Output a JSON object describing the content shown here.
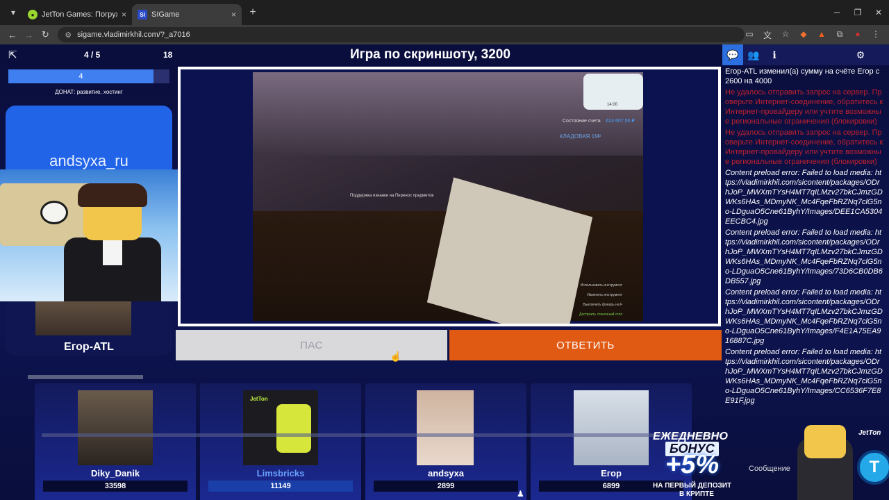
{
  "browser": {
    "tabs": [
      {
        "title": "JetTon Games: Погружение в м",
        "icon": "jetton-icon"
      },
      {
        "title": "SIGame",
        "icon": "sigame-icon",
        "favicon_text": "SI"
      }
    ],
    "url": "sigame.vladimirkhil.com/?_a7016",
    "new_tab": "+",
    "close": "×"
  },
  "game": {
    "round": "4 / 5",
    "timer": "18",
    "title": "Игра по скриншоту, 3200",
    "progress_value": "4",
    "progress_fraction": 0.9,
    "donate": "ДОНАТ: развитие, хостинг",
    "leader_banner": "andsyxa_ru",
    "leader_name": "Егор-ATL",
    "pass_button": "ПАС",
    "answer_button": "ОТВЕТИТЬ"
  },
  "question": {
    "hud_balance": "Состояние счета",
    "hud_balance_value": "624 607,50 ₽",
    "hud_room": "КЛАДОВАЯ 1М²",
    "hud_time": "14:00",
    "hint": "Поддержка изнанки на Перенос предметов",
    "legend": [
      "Использовать инструмент",
      "Изменить инструмент",
      "Выключить фонарь на F",
      "Достроить стеночный стол"
    ]
  },
  "players": [
    {
      "name": "Diky_Danik",
      "score": "33598",
      "active": false
    },
    {
      "name": "Limsbricks",
      "score": "11149",
      "active": true,
      "logo": "JetTon"
    },
    {
      "name": "andsyxa",
      "score": "2899",
      "active": false
    },
    {
      "name": "Егор",
      "score": "6899",
      "active": false
    }
  ],
  "chat": {
    "messages": [
      {
        "type": "info",
        "text": "Егор-ATL изменил(а) сумму на счёте Егор с 2600 на 4000"
      },
      {
        "type": "err",
        "text": "Не удалось отправить запрос на сервер. Проверьте Интернет-соединение, обратитесь к Интернет-провайдеру или учтите возможные региональные ограничения (блокировки)"
      },
      {
        "type": "err",
        "text": "Не удалось отправить запрос на сервер. Проверьте Интернет-соединение, обратитесь к Интернет-провайдеру или учтите возможные региональные ограничения (блокировки)"
      },
      {
        "type": "preload",
        "text": "Content preload error: Failed to load media: https://vladimirkhil.com/sicontent/packages/ODrhJoP_MWXmTYsH4MT7qILMzv27bkCJmzGDWKs6HAs_MDmyNK_Mc4FqeFbRZNq7clG5no-LDguaO5Cne61ByhY/Images/DEE1CA5304EECBC4.jpg"
      },
      {
        "type": "preload",
        "text": "Content preload error: Failed to load media: https://vladimirkhil.com/sicontent/packages/ODrhJoP_MWXmTYsH4MT7qILMzv27bkCJmzGDWKs6HAs_MDmyNK_Mc4FqeFbRZNq7clG5no-LDguaO5Cne61ByhY/Images/73D6CB0DB6DB557.jpg"
      },
      {
        "type": "preload",
        "text": "Content preload error: Failed to load media: https://vladimirkhil.com/sicontent/packages/ODrhJoP_MWXmTYsH4MT7qILMzv27bkCJmzGDWKs6HAs_MDmyNK_Mc4FqeFbRZNq7clG5no-LDguaO5Cne61ByhY/Images/F4E1A75EA916887C.jpg"
      },
      {
        "type": "preload",
        "text": "Content preload error: Failed to load media: https://vladimirkhil.com/sicontent/packages/ODrhJoP_MWXmTYsH4MT7qILMzv27bkCJmzGDWKs6HAs_MDmyNK_Mc4FqeFbRZNq7clG5no-LDguaO5Cne61ByhY/Images/CC6536F7E8E91F.jpg"
      }
    ],
    "input_placeholder": "Сообщение"
  },
  "ad": {
    "line1": "ЕЖЕДНЕВНО",
    "line2": "БОНУС",
    "line3": "+5%",
    "line4": "НА ПЕРВЫЙ ДЕПОЗИТ",
    "line5": "В КРИПТЕ",
    "brand": "JetTon",
    "coin": "T"
  },
  "colors": {
    "accent_blue": "#2b6fe0",
    "answer_orange": "#e15a14",
    "error_red": "#c0202e"
  }
}
